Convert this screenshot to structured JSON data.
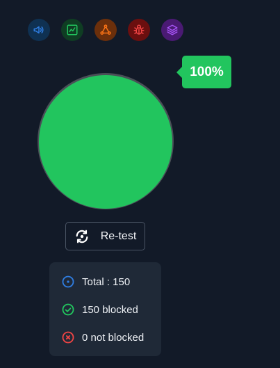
{
  "toolbar": {
    "icons": [
      {
        "name": "megaphone-icon",
        "color": "#2f7de1",
        "bg": "#0f3152"
      },
      {
        "name": "chart-line-icon",
        "color": "#22c55e",
        "bg": "#0f3d23"
      },
      {
        "name": "network-icon",
        "color": "#f97316",
        "bg": "#6b2f0b"
      },
      {
        "name": "bug-icon",
        "color": "#ef4444",
        "bg": "#6b0f0f"
      },
      {
        "name": "layers-icon",
        "color": "#a855f7",
        "bg": "#4a1a73"
      }
    ]
  },
  "gauge": {
    "percent_label": "100%",
    "percent_value": 100,
    "fill_color": "#22c55e",
    "track_color": "#4a4f57"
  },
  "retest": {
    "label": "Re-test",
    "icon": "refresh-icon"
  },
  "stats": {
    "total_label": "Total : 150",
    "blocked_label": "150 blocked",
    "not_blocked_label": "0 not blocked",
    "total_color": "#2f7de1",
    "blocked_color": "#22c55e",
    "not_blocked_color": "#ef4444"
  }
}
